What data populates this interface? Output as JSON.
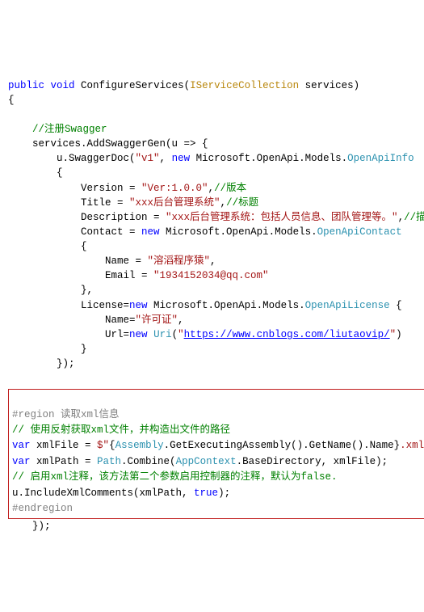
{
  "code": {
    "l1_kw1": "public",
    "l1_kw2": "void",
    "l1_method": " ConfigureServices(",
    "l1_intf": "IServiceCollection",
    "l1_rest": " services)",
    "l2": "{",
    "blank": "",
    "l4_cmt": "    //注册Swagger",
    "l5_a": "    services.AddSwaggerGen(u => {",
    "l6_a": "        u.SwaggerDoc(",
    "l6_str": "\"v1\"",
    "l6_b": ", ",
    "l6_new": "new",
    "l6_c": " Microsoft.OpenApi.Models.",
    "l6_type": "OpenApiInfo",
    "l7": "        {",
    "l8_a": "            Version = ",
    "l8_str": "\"Ver:1.0.0\"",
    "l8_b": ",",
    "l8_cmt": "//版本",
    "l9_a": "            Title = ",
    "l9_str": "\"xxx后台管理系统\"",
    "l9_b": ",",
    "l9_cmt": "//标题",
    "l10_a": "            Description = ",
    "l10_str": "\"xxx后台管理系统：包括人员信息、团队管理等。\"",
    "l10_b": ",",
    "l10_cmt": "//描述",
    "l11_a": "            Contact = ",
    "l11_new": "new",
    "l11_b": " Microsoft.OpenApi.Models.",
    "l11_type": "OpenApiContact",
    "l12": "            {",
    "l13_a": "                Name = ",
    "l13_str": "\"溶滔程序猿\"",
    "l13_b": ",",
    "l14_a": "                Email = ",
    "l14_str": "\"1934152034@qq.com\"",
    "l15": "            },",
    "l16_a": "            License=",
    "l16_new": "new",
    "l16_b": " Microsoft.OpenApi.Models.",
    "l16_type": "OpenApiLicense",
    "l16_c": " {",
    "l17_a": "                Name=",
    "l17_str": "\"许可证\"",
    "l17_b": ",",
    "l18_a": "                Url=",
    "l18_new": "new",
    "l18_b": " ",
    "l18_type": "Uri",
    "l18_c": "(",
    "l18_q": "\"",
    "l18_url": "https://www.cnblogs.com/liutaovip/",
    "l18_d": ")",
    "l19": "            }",
    "l20": "        });",
    "b1_reg": "#region",
    "b1_txt": " 读取xml信息",
    "b2_cmt": "// 使用反射获取xml文件，并构造出文件的路径",
    "b3_var": "var",
    "b3_a": " xmlFile = ",
    "b3_s1": "$\"",
    "b3_b": "{",
    "b3_t1": "Assembly",
    "b3_c": ".GetExecutingAssembly().GetName().Name}",
    "b3_s2": ".xml\"",
    "b3_d": ";",
    "b4_var": "var",
    "b4_a": " xmlPath = ",
    "b4_t1": "Path",
    "b4_b": ".Combine(",
    "b4_t2": "AppContext",
    "b4_c": ".BaseDirectory, xmlFile);",
    "b5_cmt": "// 启用xml注释，该方法第二个参数启用控制器的注释，默认为false.",
    "b6_a": "u.IncludeXmlComments(xmlPath, ",
    "b6_kw": "true",
    "b6_b": ");",
    "b7_reg": "#endregion",
    "l_end1": "    });",
    "l_end2": "}"
  }
}
